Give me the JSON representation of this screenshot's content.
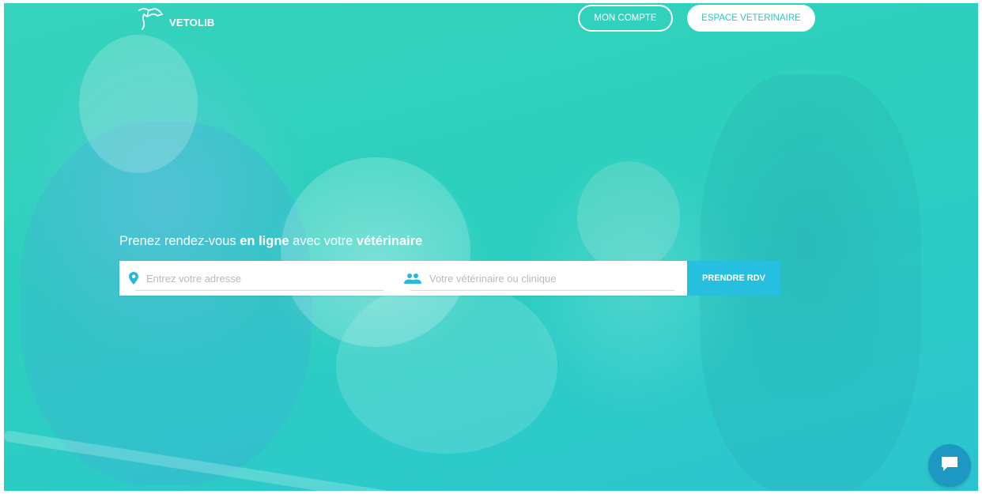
{
  "header": {
    "logo_text": "VETOLIB",
    "account_button": "MON COMPTE",
    "vet_space_button": "ESPACE VETERINAIRE"
  },
  "hero": {
    "headline": {
      "part1": "Prenez rendez-vous ",
      "bold1": "en ligne",
      "part2": " avec votre ",
      "bold2": "vétérinaire"
    }
  },
  "search": {
    "address_placeholder": "Entrez votre adresse",
    "vet_placeholder": "Votre vétérinaire ou clinique",
    "submit_label": "PRENDRE RDV"
  },
  "colors": {
    "accent": "#27bfe0",
    "brand": "#30c4b4",
    "chat": "#1d98c2"
  },
  "icons": {
    "address": "location-pin-icon",
    "vet": "people-icon",
    "chat": "chat-icon",
    "logo": "dog-outline-icon"
  }
}
